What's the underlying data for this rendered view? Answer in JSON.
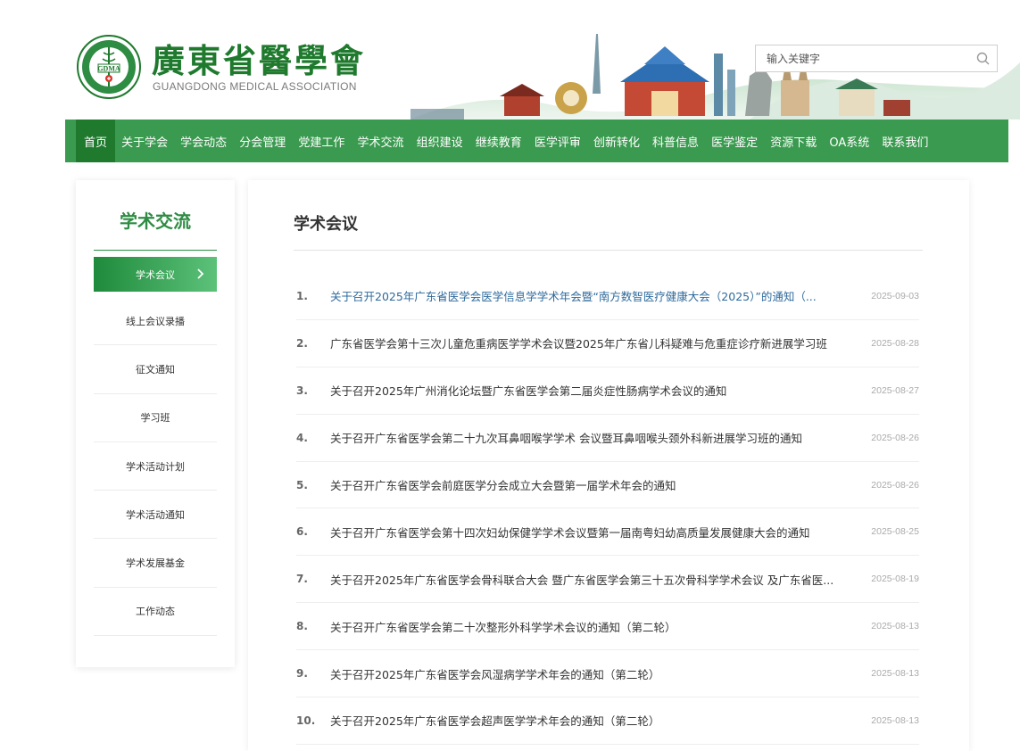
{
  "header": {
    "logo_cn": "廣東省醫學會",
    "logo_en": "GUANGDONG MEDICAL ASSOCIATION",
    "emblem_text": "GDMA",
    "search_placeholder": "输入关键字"
  },
  "nav": [
    {
      "label": "首页",
      "active": true
    },
    {
      "label": "关于学会"
    },
    {
      "label": "学会动态"
    },
    {
      "label": "分会管理"
    },
    {
      "label": "党建工作"
    },
    {
      "label": "学术交流"
    },
    {
      "label": "组织建设"
    },
    {
      "label": "继续教育"
    },
    {
      "label": "医学评审"
    },
    {
      "label": "创新转化"
    },
    {
      "label": "科普信息"
    },
    {
      "label": "医学鉴定"
    },
    {
      "label": "资源下载"
    },
    {
      "label": "OA系统"
    },
    {
      "label": "联系我们"
    }
  ],
  "sidebar": {
    "title": "学术交流",
    "items": [
      {
        "label": "学术会议",
        "active": true
      },
      {
        "label": "线上会议录播"
      },
      {
        "label": "征文通知"
      },
      {
        "label": "学习班"
      },
      {
        "label": "学术活动计划"
      },
      {
        "label": "学术活动通知"
      },
      {
        "label": "学术发展基金"
      },
      {
        "label": "工作动态"
      }
    ]
  },
  "main": {
    "title": "学术会议",
    "articles": [
      {
        "num": "1.",
        "title": "关于召开2025年广东省医学会医学信息学学术年会暨“南方数智医疗健康大会（2025）”的通知（...",
        "date": "2025-09-03"
      },
      {
        "num": "2.",
        "title": "广东省医学会第十三次儿童危重病医学学术会议暨2025年广东省儿科疑难与危重症诊疗新进展学习班",
        "date": "2025-08-28"
      },
      {
        "num": "3.",
        "title": "关于召开2025年广州消化论坛暨广东省医学会第二届炎症性肠病学术会议的通知",
        "date": "2025-08-27"
      },
      {
        "num": "4.",
        "title": "关于召开广东省医学会第二十九次耳鼻咽喉学学术 会议暨耳鼻咽喉头颈外科新进展学习班的通知",
        "date": "2025-08-26"
      },
      {
        "num": "5.",
        "title": "关于召开广东省医学会前庭医学分会成立大会暨第一届学术年会的通知",
        "date": "2025-08-26"
      },
      {
        "num": "6.",
        "title": "关于召开广东省医学会第十四次妇幼保健学学术会议暨第一届南粤妇幼高质量发展健康大会的通知",
        "date": "2025-08-25"
      },
      {
        "num": "7.",
        "title": "关于召开2025年广东省医学会骨科联合大会 暨广东省医学会第三十五次骨科学学术会议 及广东省医...",
        "date": "2025-08-19"
      },
      {
        "num": "8.",
        "title": "关于召开广东省医学会第二十次整形外科学学术会议的通知（第二轮）",
        "date": "2025-08-13"
      },
      {
        "num": "9.",
        "title": "关于召开2025年广东省医学会风湿病学学术年会的通知（第二轮）",
        "date": "2025-08-13"
      },
      {
        "num": "10.",
        "title": "关于召开2025年广东省医学会超声医学学术年会的通知（第二轮）",
        "date": "2025-08-13"
      }
    ]
  }
}
